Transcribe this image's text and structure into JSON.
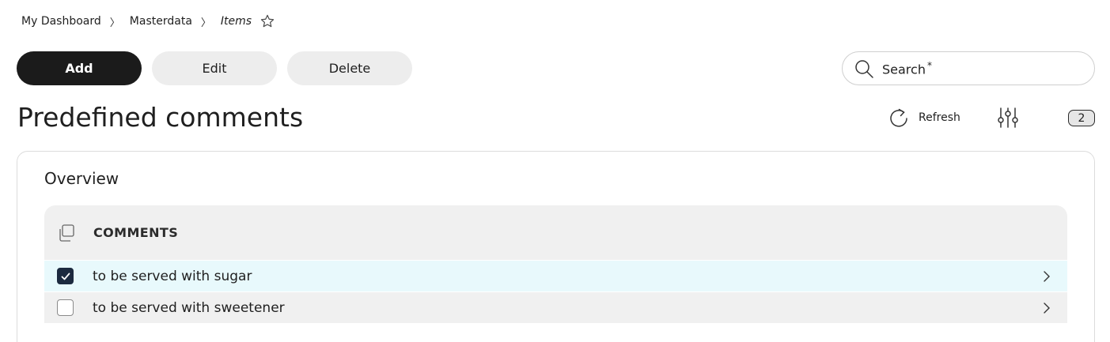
{
  "breadcrumb": {
    "items": [
      "My Dashboard",
      "Masterdata",
      "Items"
    ],
    "separator": "〉"
  },
  "toolbar": {
    "add_label": "Add",
    "edit_label": "Edit",
    "delete_label": "Delete"
  },
  "search": {
    "placeholder": "Search",
    "required_mark": "*"
  },
  "page": {
    "title": "Predefined comments",
    "refresh_label": "Refresh",
    "count": "2"
  },
  "overview": {
    "title": "Overview",
    "columns": [
      "COMMENTS"
    ],
    "rows": [
      {
        "comment": "to be served with sugar",
        "checked": true
      },
      {
        "comment": "to be served with sweetener",
        "checked": false
      }
    ]
  },
  "colors": {
    "primary_button": "#1b1b1b",
    "secondary_button": "#ededed",
    "selected_row": "#e8f9fc",
    "checkbox_checked": "#1c2a3f"
  },
  "icons": {
    "favorite": "star-outline-icon",
    "search": "search-icon",
    "refresh": "refresh-icon",
    "filters": "sliders-icon",
    "select_all": "copy-icon",
    "row_open": "chevron-right-icon"
  }
}
